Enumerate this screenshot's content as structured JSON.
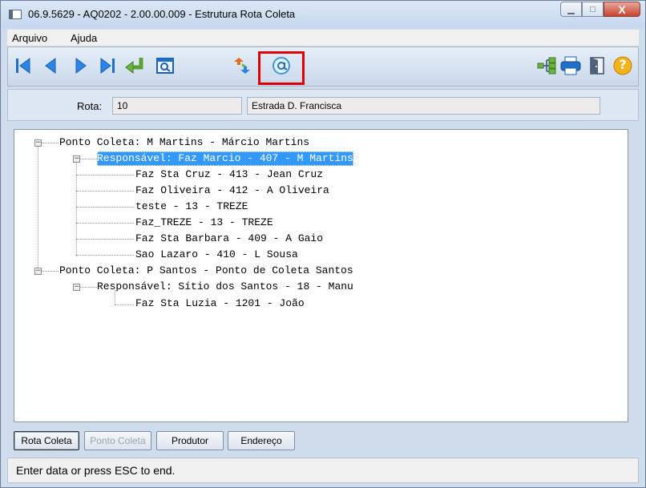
{
  "window": {
    "title": "06.9.5629 - AQ0202 - 2.00.00.009 - Estrutura Rota Coleta",
    "controls": {
      "minimize": "▁",
      "maximize": "□",
      "close": "X"
    }
  },
  "menu": {
    "items": [
      {
        "label": "Arquivo"
      },
      {
        "label": "Ajuda"
      }
    ]
  },
  "toolbar": {
    "icons": [
      "first-record-icon",
      "previous-record-icon",
      "next-record-icon",
      "last-record-icon",
      "return-icon",
      "search-window-icon",
      "refresh-arrows-icon",
      "at-sign-icon",
      "tree-structure-icon",
      "printer-icon",
      "exit-door-icon",
      "help-icon"
    ],
    "help_label": "?"
  },
  "rota": {
    "label": "Rota:",
    "code": "10",
    "description": "Estrada D. Francisca"
  },
  "tree": {
    "nodes": [
      {
        "text": "Ponto Coleta: M Martins - Márcio Martins"
      },
      {
        "text": "Responsável: Faz Marcio - 407 - M Martins"
      },
      {
        "text": "Faz Sta Cruz - 413 - Jean Cruz"
      },
      {
        "text": "Faz Oliveira - 412 - A Oliveira"
      },
      {
        "text": "teste - 13 - TREZE"
      },
      {
        "text": "Faz_TREZE - 13 - TREZE"
      },
      {
        "text": "Faz Sta Barbara - 409 - A Gaio"
      },
      {
        "text": "Sao Lazaro - 410 - L Sousa"
      },
      {
        "text": "Ponto Coleta: P Santos - Ponto de Coleta Santos"
      },
      {
        "text": "Responsável: Sítio dos Santos - 18 - Manu"
      },
      {
        "text": "Faz Sta Luzia - 1201 - João"
      }
    ],
    "expander_symbol": "−"
  },
  "buttons": {
    "rota_coleta": "Rota Coleta",
    "ponto_coleta": "Ponto Coleta",
    "produtor": "Produtor",
    "endereco": "Endereço"
  },
  "status": {
    "text": "Enter data or press ESC to end."
  },
  "colors": {
    "selection": "#3399ff",
    "highlight_box": "#e00000",
    "toolbar_blue": "#1f6fc9",
    "toolbar_green": "#6cb43f"
  }
}
